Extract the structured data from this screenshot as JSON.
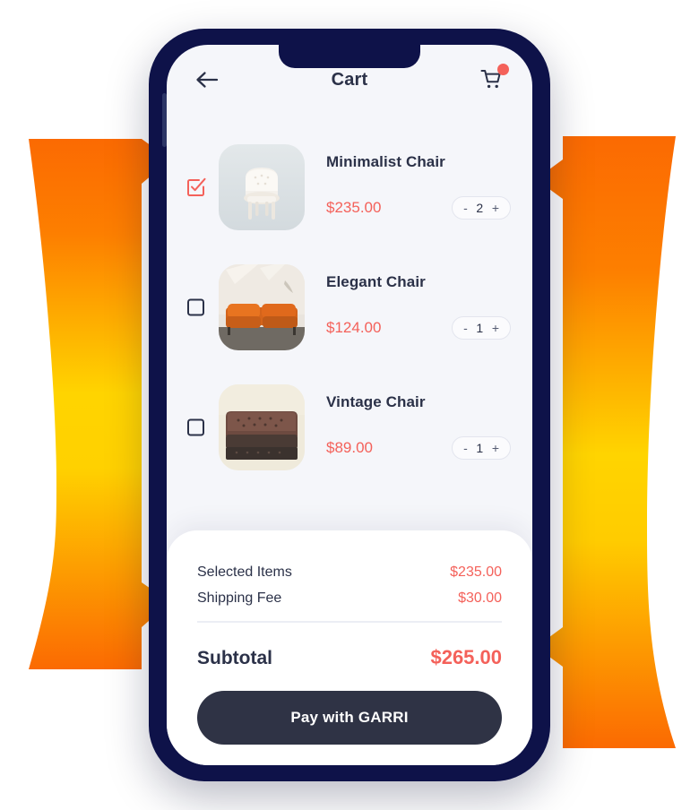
{
  "header": {
    "title": "Cart",
    "back_icon": "arrow-left-icon",
    "cart_icon": "shopping-cart-icon",
    "badge": ""
  },
  "colors": {
    "frame": "#0e1249",
    "screen_bg": "#f5f6fa",
    "accent_red": "#f4615a",
    "text_dark": "#2b3148",
    "pay_button": "#2f3345",
    "ribbon_orange": "#fb6a02",
    "ribbon_yellow": "#ffd400"
  },
  "items": [
    {
      "name": "Minimalist Chair",
      "price": "$235.00",
      "quantity": "2",
      "selected": true,
      "thumb": "white-tufted-armchair",
      "minus": "-",
      "plus": "+"
    },
    {
      "name": "Elegant Chair",
      "price": "$124.00",
      "quantity": "1",
      "selected": false,
      "thumb": "orange-leather-sofa",
      "minus": "-",
      "plus": "+"
    },
    {
      "name": "Vintage Chair",
      "price": "$89.00",
      "quantity": "1",
      "selected": false,
      "thumb": "brown-chesterfield-sofa",
      "minus": "-",
      "plus": "+"
    }
  ],
  "summary": {
    "rows": [
      {
        "label": "Selected Items",
        "value": "$235.00"
      },
      {
        "label": "Shipping Fee",
        "value": "$30.00"
      }
    ],
    "total_label": "Subtotal",
    "total_value": "$265.00",
    "pay_label": "Pay with GARRI"
  }
}
